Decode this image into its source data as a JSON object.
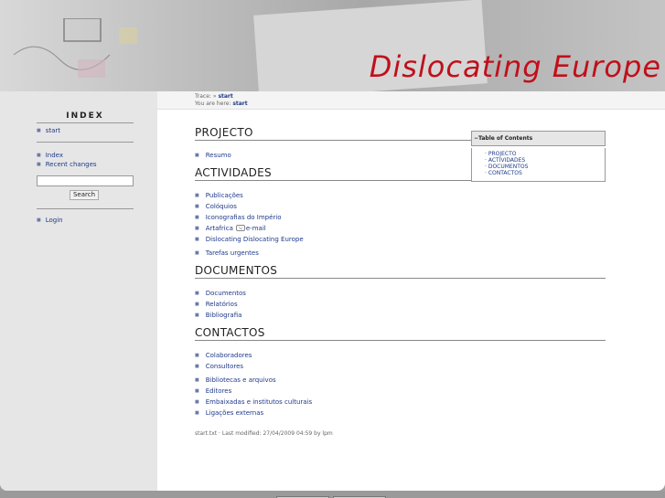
{
  "banner": {
    "title": "Dislocating Europe"
  },
  "sidebar": {
    "heading": "INDEX",
    "items_top": [
      {
        "label": "start"
      }
    ],
    "items_mid": [
      {
        "label": "Index"
      },
      {
        "label": "Recent changes"
      }
    ],
    "search_button": "Search",
    "items_bottom": [
      {
        "label": "Login"
      }
    ]
  },
  "trace": {
    "prefix": "Trace: » ",
    "trace_link": "start",
    "here_prefix": "You are here: ",
    "here_link": "start"
  },
  "sections": {
    "projecto": {
      "heading": "PROJECTO",
      "items": [
        "Resumo"
      ]
    },
    "actividades": {
      "heading": "ACTIVIDADES",
      "items": [
        "Publicações",
        "Colóquios",
        "Iconografias do Império"
      ],
      "artafrica_label": "Artafrica",
      "email_label": "e-mail",
      "items2": [
        "Dislocating Dislocating Europe",
        "Tarefas urgentes"
      ]
    },
    "documentos": {
      "heading": "DOCUMENTOS",
      "items": [
        "Documentos",
        "Relatórios",
        "Bibliografia"
      ]
    },
    "contactos": {
      "heading": "CONTACTOS",
      "items": [
        "Colaboradores",
        "Consultores",
        "Bibliotecas e arquivos",
        "Editores",
        "Embaixadas e institutos culturais",
        "Ligações externas"
      ]
    }
  },
  "toc": {
    "heading": "−Table of Contents",
    "items": [
      "PROJECTO",
      "ACTIVIDADES",
      "DOCUMENTOS",
      "CONTACTOS"
    ]
  },
  "footer": {
    "meta": "start.txt · Last modified: 27/04/2009 04:59 by lpm"
  },
  "colors": {
    "accent_red": "#c0101b",
    "link_blue": "#1e3a8a",
    "sidebar_bg": "#e6e6e6"
  },
  "icons": {
    "bullet": "square-bullet-icon",
    "mail": "mail-icon"
  }
}
